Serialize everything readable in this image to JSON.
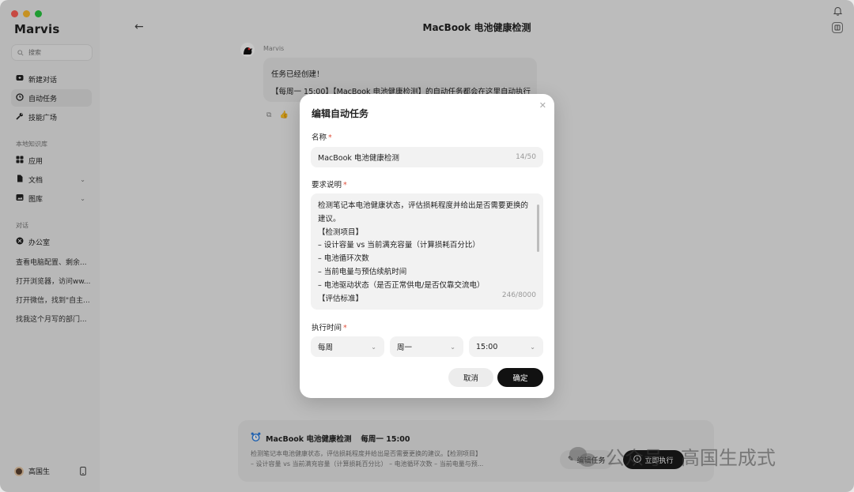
{
  "app": {
    "name": "Marvis"
  },
  "sidebar": {
    "search_placeholder": "搜索",
    "nav": [
      {
        "label": "新建对话",
        "icon": "new-chat-icon"
      },
      {
        "label": "自动任务",
        "icon": "clock-icon"
      },
      {
        "label": "技能广场",
        "icon": "wrench-icon"
      }
    ],
    "knowledge_title": "本地知识库",
    "knowledge": [
      {
        "label": "应用",
        "icon": "grid-icon"
      },
      {
        "label": "文档",
        "icon": "document-icon"
      },
      {
        "label": "图库",
        "icon": "image-icon"
      }
    ],
    "chats_title": "对话",
    "chats": [
      "办公室",
      "查看电脑配置、剩余...",
      "打开浏览器，访问ww...",
      "打开微信，找到\"自主...",
      "找我这个月写的部门..."
    ],
    "user_name": "高国生"
  },
  "header": {
    "title": "MacBook 电池健康检测"
  },
  "chat": {
    "bot_name": "Marvis",
    "bubble_line1": "任务已经创建！",
    "bubble_line2": "【每周一 15:00】【MacBook 电池健康检测】的自动任务都会在这里自动执行"
  },
  "task_card": {
    "title": "MacBook 电池健康检测",
    "schedule": "每周一 15:00",
    "desc_line1": "检测笔记本电池健康状态，评估损耗程度并给出是否需要更换的建议。【检测项目】",
    "desc_line2": "– 设计容量 vs 当前满充容量（计算损耗百分比） – 电池循环次数 – 当前电量与预...",
    "edit_label": "编辑任务",
    "run_label": "立即执行"
  },
  "watermark": {
    "text": "公众号 · 高国生成式"
  },
  "modal": {
    "title": "编辑自动任务",
    "name_label": "名称",
    "name_value": "MacBook 电池健康检测",
    "name_counter": "14/50",
    "desc_label": "要求说明",
    "desc_lines": [
      "检测笔记本电池健康状态，评估损耗程度并给出是否需要更换的",
      "建议。",
      "【检测项目】",
      "– 设计容量 vs 当前满充容量（计算损耗百分比）",
      "– 电池循环次数",
      "– 当前电量与预估续航时间",
      "– 电池驱动状态（是否正常供电/是否仅靠交流电）",
      "【评估标准】"
    ],
    "desc_counter": "246/8000",
    "time_label": "执行时间",
    "frequency": "每周",
    "weekday": "周一",
    "time": "15:00",
    "cancel_label": "取消",
    "confirm_label": "确定"
  },
  "colors": {
    "accent_dark": "#111111",
    "required_star": "#e0513c",
    "traffic_red": "#ff5f57",
    "traffic_yellow": "#febc2e",
    "traffic_green": "#28c840"
  }
}
